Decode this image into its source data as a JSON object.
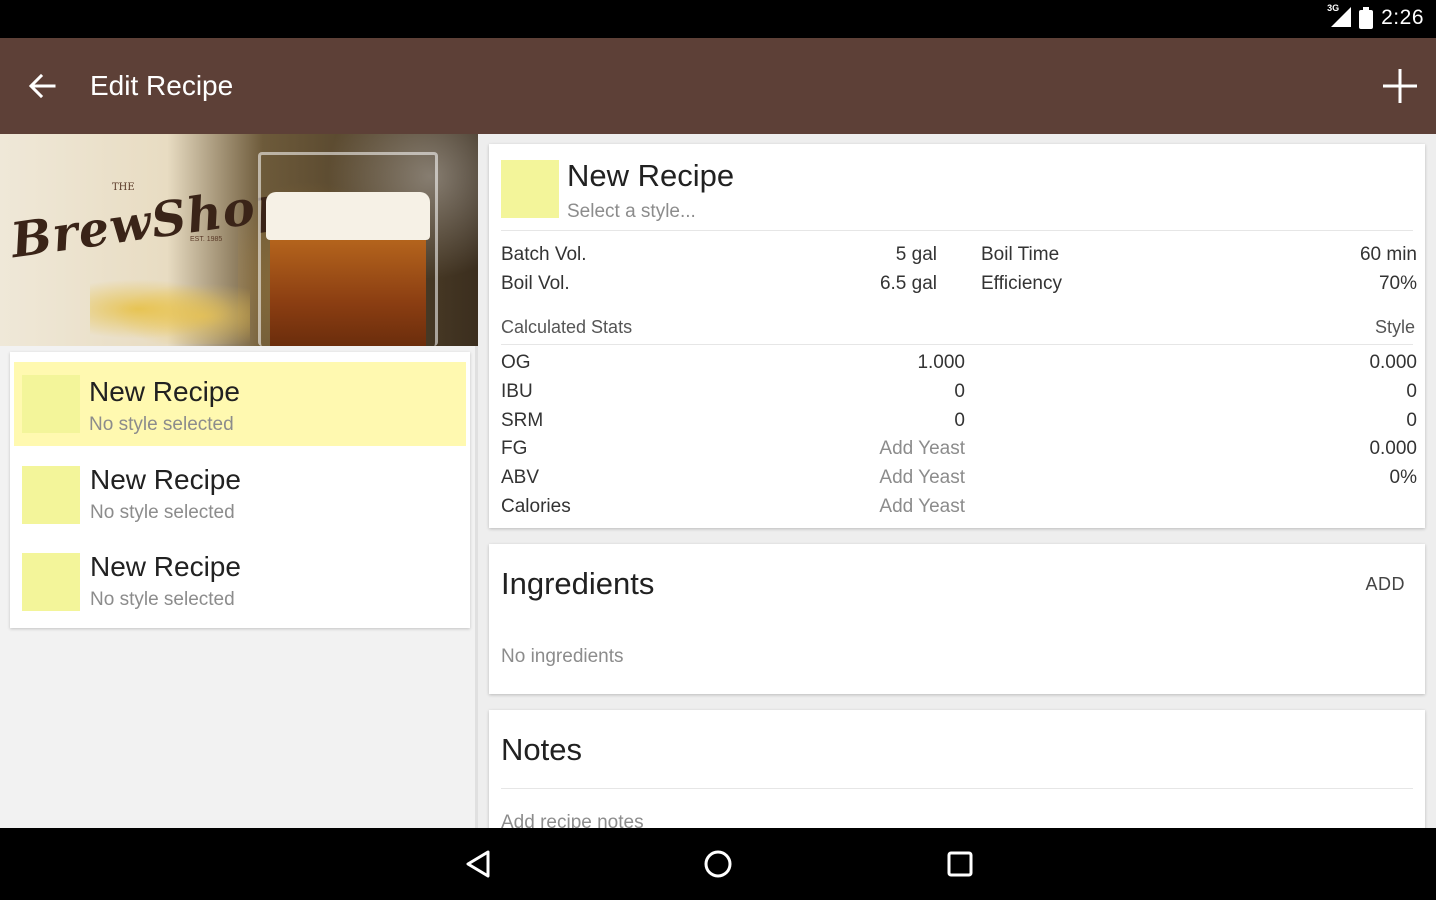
{
  "status_bar": {
    "network": "3G",
    "time": "2:26"
  },
  "app_bar": {
    "title": "Edit Recipe",
    "back_icon": "arrow-back-icon",
    "add_icon": "plus-icon",
    "color": "#5d4037"
  },
  "banner": {
    "the": "THE",
    "logo": "BrewShop",
    "est": "EST. 1985"
  },
  "recipe_list": [
    {
      "name": "New Recipe",
      "style": "No style selected",
      "selected": true
    },
    {
      "name": "New Recipe",
      "style": "No style selected",
      "selected": false
    },
    {
      "name": "New Recipe",
      "style": "No style selected",
      "selected": false
    }
  ],
  "recipe": {
    "name": "New Recipe",
    "style_placeholder": "Select a style...",
    "swatch_color": "#f3f59a",
    "params": {
      "batch_vol_label": "Batch Vol.",
      "batch_vol": "5 gal",
      "boil_vol_label": "Boil Vol.",
      "boil_vol": "6.5 gal",
      "boil_time_label": "Boil Time",
      "boil_time": "60 min",
      "efficiency_label": "Efficiency",
      "efficiency": "70%"
    },
    "stats_header": "Calculated Stats",
    "style_header": "Style",
    "stats": [
      {
        "label": "OG",
        "calc": "1.000",
        "style": "0.000"
      },
      {
        "label": "IBU",
        "calc": "0",
        "style": "0"
      },
      {
        "label": "SRM",
        "calc": "0",
        "style": "0"
      },
      {
        "label": "FG",
        "calc": "Add Yeast",
        "style": "0.000"
      },
      {
        "label": "ABV",
        "calc": "Add Yeast",
        "style": "0%"
      },
      {
        "label": "Calories",
        "calc": "Add Yeast",
        "style": ""
      }
    ]
  },
  "ingredients": {
    "title": "Ingredients",
    "add_label": "ADD",
    "empty": "No ingredients"
  },
  "notes": {
    "title": "Notes",
    "placeholder": "Add recipe notes"
  },
  "nav_bar": {
    "back_icon": "nav-back-icon",
    "home_icon": "nav-home-icon",
    "recents_icon": "nav-recents-icon"
  }
}
